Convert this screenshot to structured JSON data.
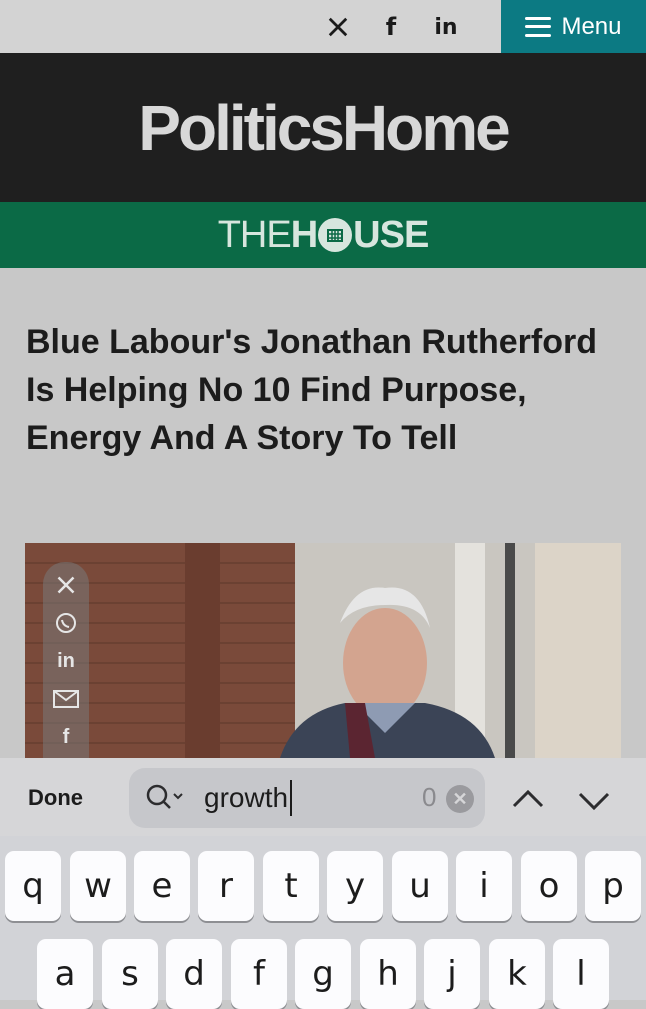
{
  "topbar": {
    "social": [
      {
        "name": "x-icon",
        "glyph": "𝕏"
      },
      {
        "name": "facebook-icon",
        "glyph": "f"
      },
      {
        "name": "linkedin-icon",
        "glyph": "in"
      }
    ],
    "menu_label": "Menu",
    "menu_color": "#0c7a83"
  },
  "brand": {
    "logo": "PoliticsHome",
    "section_thin": "THE",
    "section_bold_before": "H",
    "section_bold_after": "USE",
    "section_color": "#0b6a46"
  },
  "article": {
    "headline": "Blue Labour's Jonathan Rutherford Is Helping No 10 Find Purpose, Energy And A Story To Tell"
  },
  "share_rail": [
    {
      "name": "x-icon",
      "glyph": "𝕏"
    },
    {
      "name": "whatsapp-icon",
      "glyph": "◯"
    },
    {
      "name": "linkedin-icon",
      "glyph": "in"
    },
    {
      "name": "email-icon",
      "glyph": "✉"
    },
    {
      "name": "facebook-icon",
      "glyph": "f"
    }
  ],
  "find_bar": {
    "done_label": "Done",
    "query": "growth",
    "match_count": "0"
  },
  "keyboard": {
    "row1": [
      "q",
      "w",
      "e",
      "r",
      "t",
      "y",
      "u",
      "i",
      "o",
      "p"
    ],
    "row2": [
      "a",
      "s",
      "d",
      "f",
      "g",
      "h",
      "j",
      "k",
      "l"
    ]
  }
}
